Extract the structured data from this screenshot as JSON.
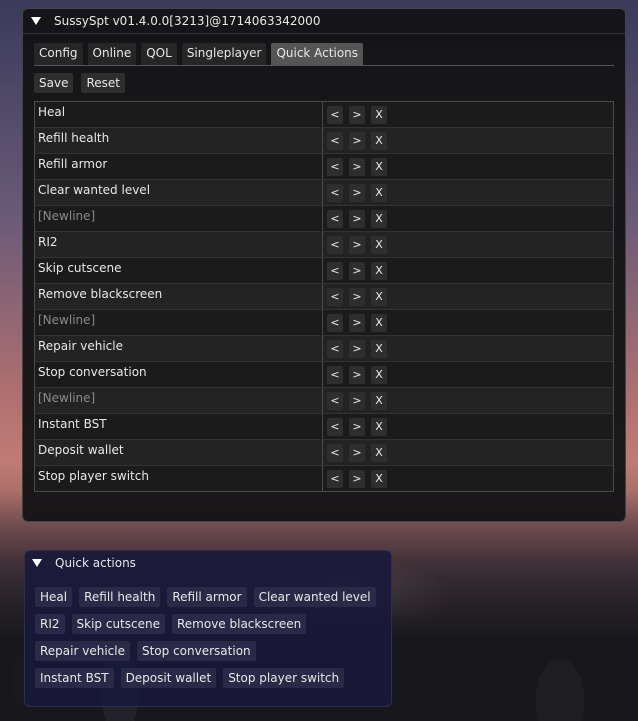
{
  "window": {
    "title": "SussySpt v01.4.0.0[3213]@1714063342000",
    "tabs": [
      "Config",
      "Online",
      "QOL",
      "Singleplayer",
      "Quick Actions"
    ],
    "active_tab": "Quick Actions",
    "toolbar": {
      "save_label": "Save",
      "reset_label": "Reset"
    },
    "rows": [
      {
        "name": "Heal",
        "newline": false
      },
      {
        "name": "Refill health",
        "newline": false
      },
      {
        "name": "Refill armor",
        "newline": false
      },
      {
        "name": "Clear wanted level",
        "newline": false
      },
      {
        "name": "[Newline]",
        "newline": true
      },
      {
        "name": "RI2",
        "newline": false
      },
      {
        "name": "Skip cutscene",
        "newline": false
      },
      {
        "name": "Remove blackscreen",
        "newline": false
      },
      {
        "name": "[Newline]",
        "newline": true
      },
      {
        "name": "Repair vehicle",
        "newline": false
      },
      {
        "name": "Stop conversation",
        "newline": false
      },
      {
        "name": "[Newline]",
        "newline": true
      },
      {
        "name": "Instant BST",
        "newline": false
      },
      {
        "name": "Deposit wallet",
        "newline": false
      },
      {
        "name": "Stop player switch",
        "newline": false
      }
    ],
    "row_controls": {
      "up": "<",
      "down": ">",
      "remove": "X"
    }
  },
  "quick_actions": {
    "title": "Quick actions",
    "rows": [
      [
        "Heal",
        "Refill health",
        "Refill armor",
        "Clear wanted level"
      ],
      [
        "RI2",
        "Skip cutscene",
        "Remove blackscreen"
      ],
      [
        "Repair vehicle",
        "Stop conversation"
      ],
      [
        "Instant BST",
        "Deposit wallet",
        "Stop player switch"
      ]
    ]
  }
}
